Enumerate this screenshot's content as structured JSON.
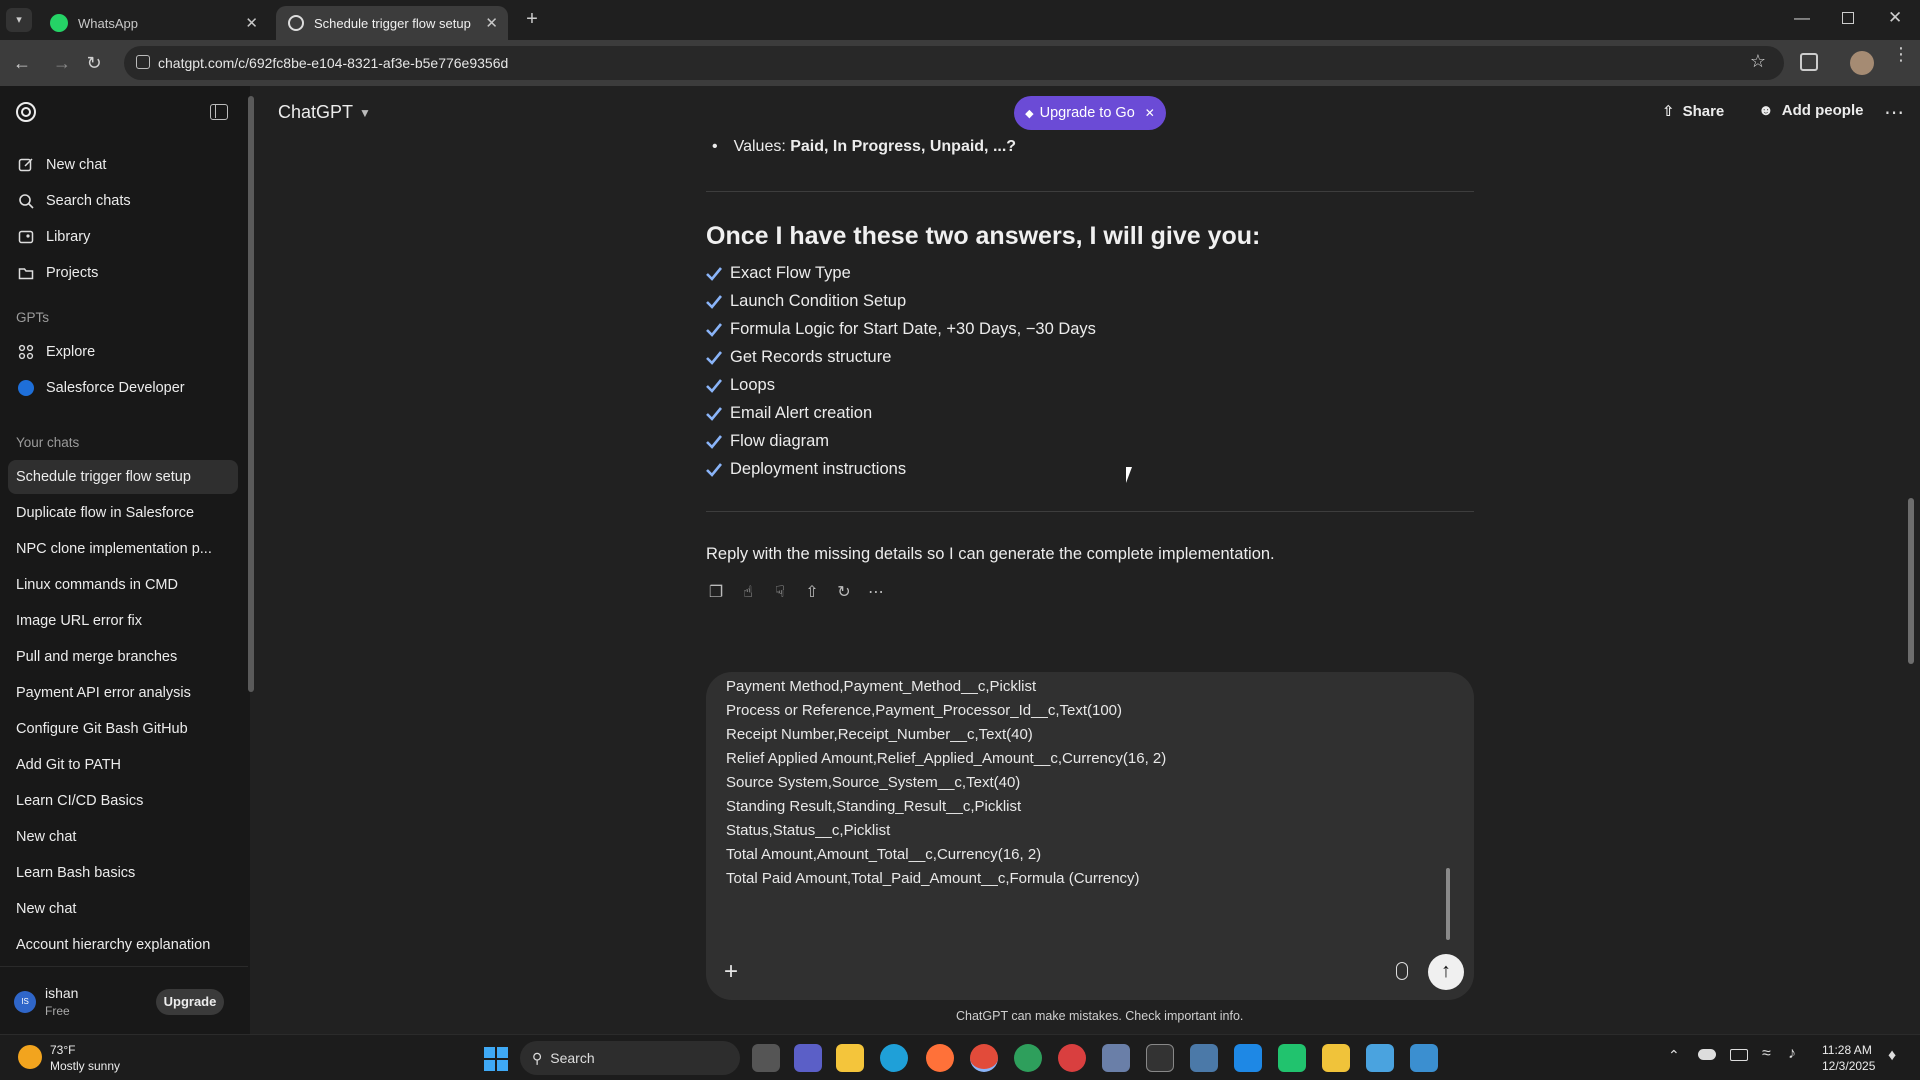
{
  "browser": {
    "tabs": [
      {
        "label": "WhatsApp",
        "active": false
      },
      {
        "label": "Schedule trigger flow setup",
        "active": true
      }
    ],
    "url": "chatgpt.com/c/692fc8be-e104-8321-af3e-b5e776e9356d"
  },
  "sidebar": {
    "top_items": [
      {
        "label": "New chat",
        "icon": "edit-icon"
      },
      {
        "label": "Search chats",
        "icon": "search-icon"
      },
      {
        "label": "Library",
        "icon": "library-icon"
      },
      {
        "label": "Projects",
        "icon": "folder-icon"
      }
    ],
    "gpts_label": "GPTs",
    "gpts": [
      {
        "label": "Explore",
        "icon": "grid-icon"
      },
      {
        "label": "Salesforce Developer",
        "icon": "salesforce-icon"
      }
    ],
    "your_chats_label": "Your chats",
    "chats": [
      "Schedule trigger flow setup",
      "Duplicate flow in Salesforce",
      "NPC clone implementation p...",
      "Linux commands in CMD",
      "Image URL error fix",
      "Pull and merge branches",
      "Payment API error analysis",
      "Configure Git Bash GitHub",
      "Add Git to PATH",
      "Learn CI/CD Basics",
      "New chat",
      "Learn Bash basics",
      "New chat",
      "Account hierarchy explanation"
    ],
    "user": {
      "initials": "IS",
      "name": "ishan",
      "plan": "Free",
      "upgrade_label": "Upgrade"
    }
  },
  "header": {
    "model": "ChatGPT",
    "upgrade_pill": "Upgrade to Go",
    "share": "Share",
    "add_people": "Add people"
  },
  "message": {
    "values_prefix": "Values: ",
    "values_bold": "Paid, In Progress, Unpaid, ...?",
    "heading": "Once I have these two answers, I will give you:",
    "checklist": [
      "Exact Flow Type",
      "Launch Condition Setup",
      "Formula Logic for Start Date, +30 Days, −30 Days",
      "Get Records structure",
      "Loops",
      "Email Alert creation",
      "Flow diagram",
      "Deployment instructions"
    ],
    "closing": "Reply with the missing details so I can generate the complete implementation."
  },
  "composer": {
    "lines": [
      "Payment Method,Payment_Method__c,Picklist",
      "Process or Reference,Payment_Processor_Id__c,Text(100)",
      "Receipt Number,Receipt_Number__c,Text(40)",
      "Relief Applied Amount,Relief_Applied_Amount__c,Currency(16, 2)",
      "Source System,Source_System__c,Text(40)",
      "Standing Result,Standing_Result__c,Picklist",
      "Status,Status__c,Picklist",
      "Total Amount,Amount_Total__c,Currency(16, 2)",
      "Total Paid Amount,Total_Paid_Amount__c,Formula (Currency)"
    ]
  },
  "disclaimer": "ChatGPT can make mistakes. Check important info.",
  "taskbar": {
    "weather_temp": "73°F",
    "weather_desc": "Mostly sunny",
    "search": "Search",
    "time": "11:28 AM",
    "date": "12/3/2025"
  }
}
